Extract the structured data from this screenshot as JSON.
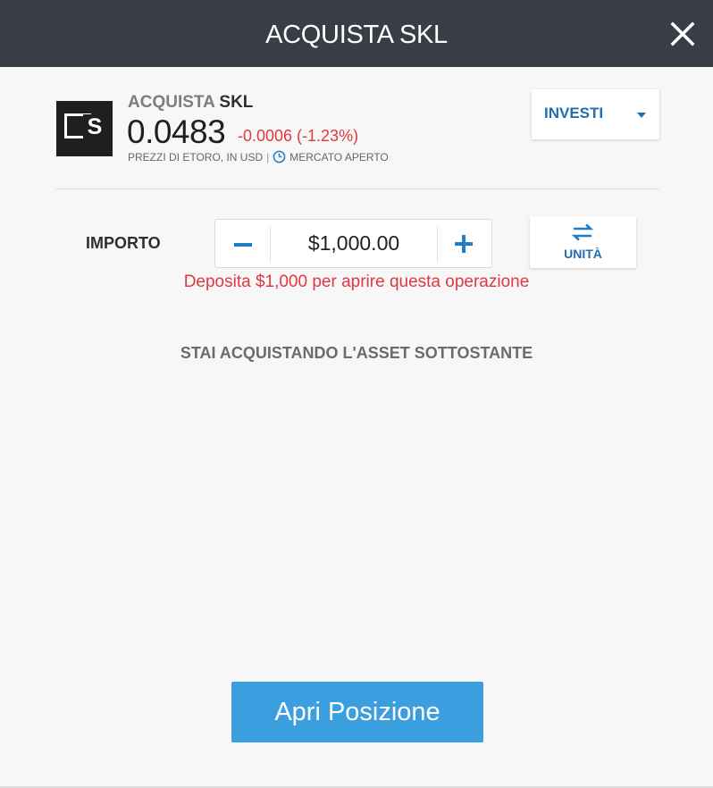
{
  "header": {
    "title": "ACQUISTA SKL",
    "close_icon": "close-icon"
  },
  "asset": {
    "logo_letter": "S",
    "action": "ACQUISTA",
    "symbol": "SKL",
    "price": "0.0483",
    "change": "-0.0006 (-1.23%)",
    "price_source": "PREZZI DI ETORO, IN USD",
    "separator": "|",
    "market_status": "MERCATO APERTO"
  },
  "invest_dropdown": {
    "selected": "INVESTI"
  },
  "amount": {
    "label": "IMPORTO",
    "value": "$1,000.00",
    "units_label": "UNITÀ"
  },
  "warning": "Deposita $1,000 per aprire questa operazione",
  "underlying_notice": "STAI ACQUISTANDO L'ASSET SOTTOSTANTE",
  "actions": {
    "open_position": "Apri Posizione"
  },
  "colors": {
    "header_bg": "#393d46",
    "accent_blue": "#1e6fb3",
    "button_blue": "#3b9ede",
    "negative_red": "#e0383e"
  }
}
